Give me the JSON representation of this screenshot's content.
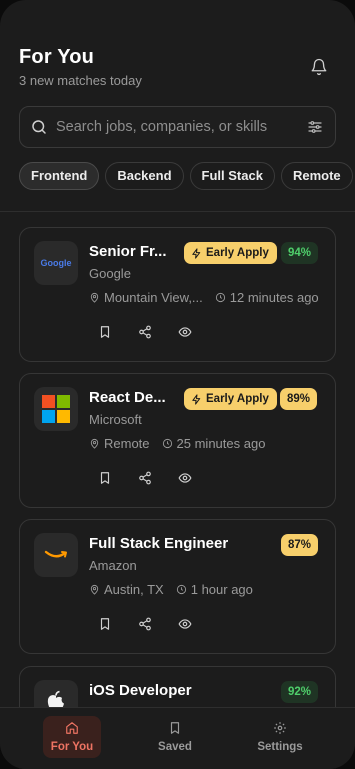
{
  "header": {
    "title": "For You",
    "subtitle": "3 new matches today"
  },
  "search": {
    "placeholder": "Search jobs, companies, or skills"
  },
  "filters": [
    {
      "label": "Frontend",
      "active": true
    },
    {
      "label": "Backend",
      "active": false
    },
    {
      "label": "Full Stack",
      "active": false
    },
    {
      "label": "Remote",
      "active": false
    }
  ],
  "jobs": [
    {
      "title": "Senior Fr...",
      "company": "Google",
      "location": "Mountain View,...",
      "time": "12 minutes ago",
      "early_apply": "Early Apply",
      "match": "94%",
      "logo_text": "Google"
    },
    {
      "title": "React De...",
      "company": "Microsoft",
      "location": "Remote",
      "time": "25 minutes ago",
      "early_apply": "Early Apply",
      "match": "89%"
    },
    {
      "title": "Full Stack Engineer",
      "company": "Amazon",
      "location": "Austin, TX",
      "time": "1 hour ago",
      "match": "87%"
    },
    {
      "title": "iOS Developer",
      "match": "92%"
    }
  ],
  "nav": [
    {
      "label": "For You",
      "icon": "home-icon",
      "active": true
    },
    {
      "label": "Saved",
      "icon": "bookmark-icon",
      "active": false
    },
    {
      "label": "Settings",
      "icon": "gear-icon",
      "active": false
    }
  ],
  "colors": {
    "accent": "#ee7463",
    "badge": "#f7cf6b",
    "match_green": "#4fcf6b",
    "background": "#1c1c1c"
  }
}
